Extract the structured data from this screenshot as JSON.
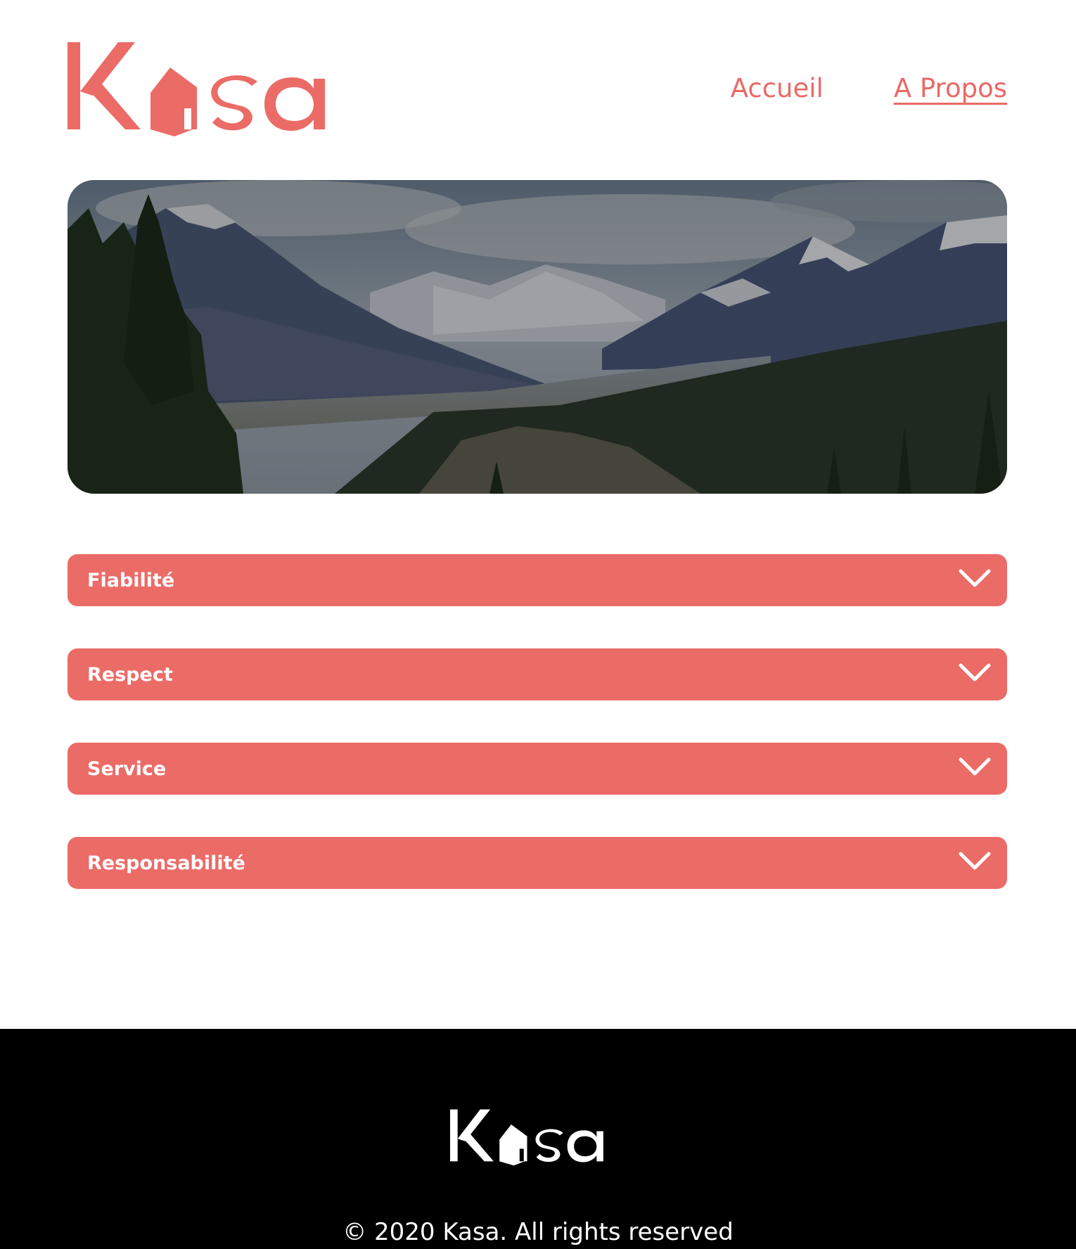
{
  "brand": {
    "name": "Kasa",
    "accent_color": "#EB6B67"
  },
  "nav": {
    "items": [
      {
        "label": "Accueil",
        "active": false
      },
      {
        "label": "A Propos",
        "active": true
      }
    ]
  },
  "banner": {
    "alt": "mountain-landscape"
  },
  "collapses": [
    {
      "title": "Fiabilité",
      "icon": "chevron-down-icon"
    },
    {
      "title": "Respect",
      "icon": "chevron-down-icon"
    },
    {
      "title": "Service",
      "icon": "chevron-down-icon"
    },
    {
      "title": "Responsabilité",
      "icon": "chevron-down-icon"
    }
  ],
  "footer": {
    "copyright": "© 2020 Kasa. All rights reserved"
  }
}
